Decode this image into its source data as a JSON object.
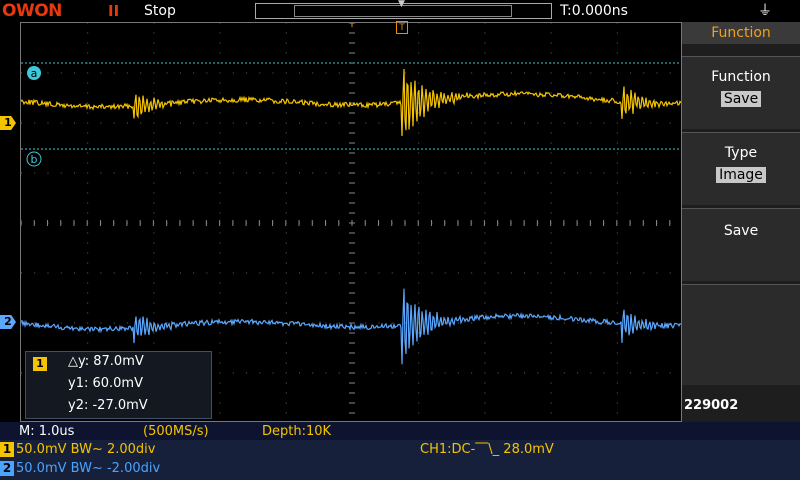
{
  "topbar": {
    "brand": "OWON",
    "run_state_icon": "II",
    "run_state": "Stop",
    "trigger_time": "T:0.000ns",
    "usb_icon": "usb-icon"
  },
  "screen": {
    "cursor_a_label": "a",
    "cursor_b_label": "b",
    "ch1_marker": "1",
    "ch2_marker": "2",
    "trigger_marker": "T",
    "ch1_color": "#f5c400",
    "ch2_color": "#5aa8ff"
  },
  "measurement": {
    "channel": "1",
    "delta_y": "△y: 87.0mV",
    "y1": "y1: 60.0mV",
    "y2": "y2: -27.0mV"
  },
  "side_menu": {
    "header": "Function",
    "items": [
      {
        "title": "Function",
        "value": "Save"
      },
      {
        "title": "Type",
        "value": "Image"
      },
      {
        "title": "Save",
        "value": ""
      }
    ],
    "serial": "229002"
  },
  "status": {
    "timebase": "M: 1.0us",
    "sample_rate": "(500MS/s)",
    "depth": "Depth:10K",
    "ch1": {
      "badge": "1",
      "text": "50.0mV BW~ 2.00div"
    },
    "ch2": {
      "badge": "2",
      "text": "50.0mV BW~ -2.00div"
    },
    "trigger": "CH1:DC-⎺\\_ 28.0mV"
  }
}
